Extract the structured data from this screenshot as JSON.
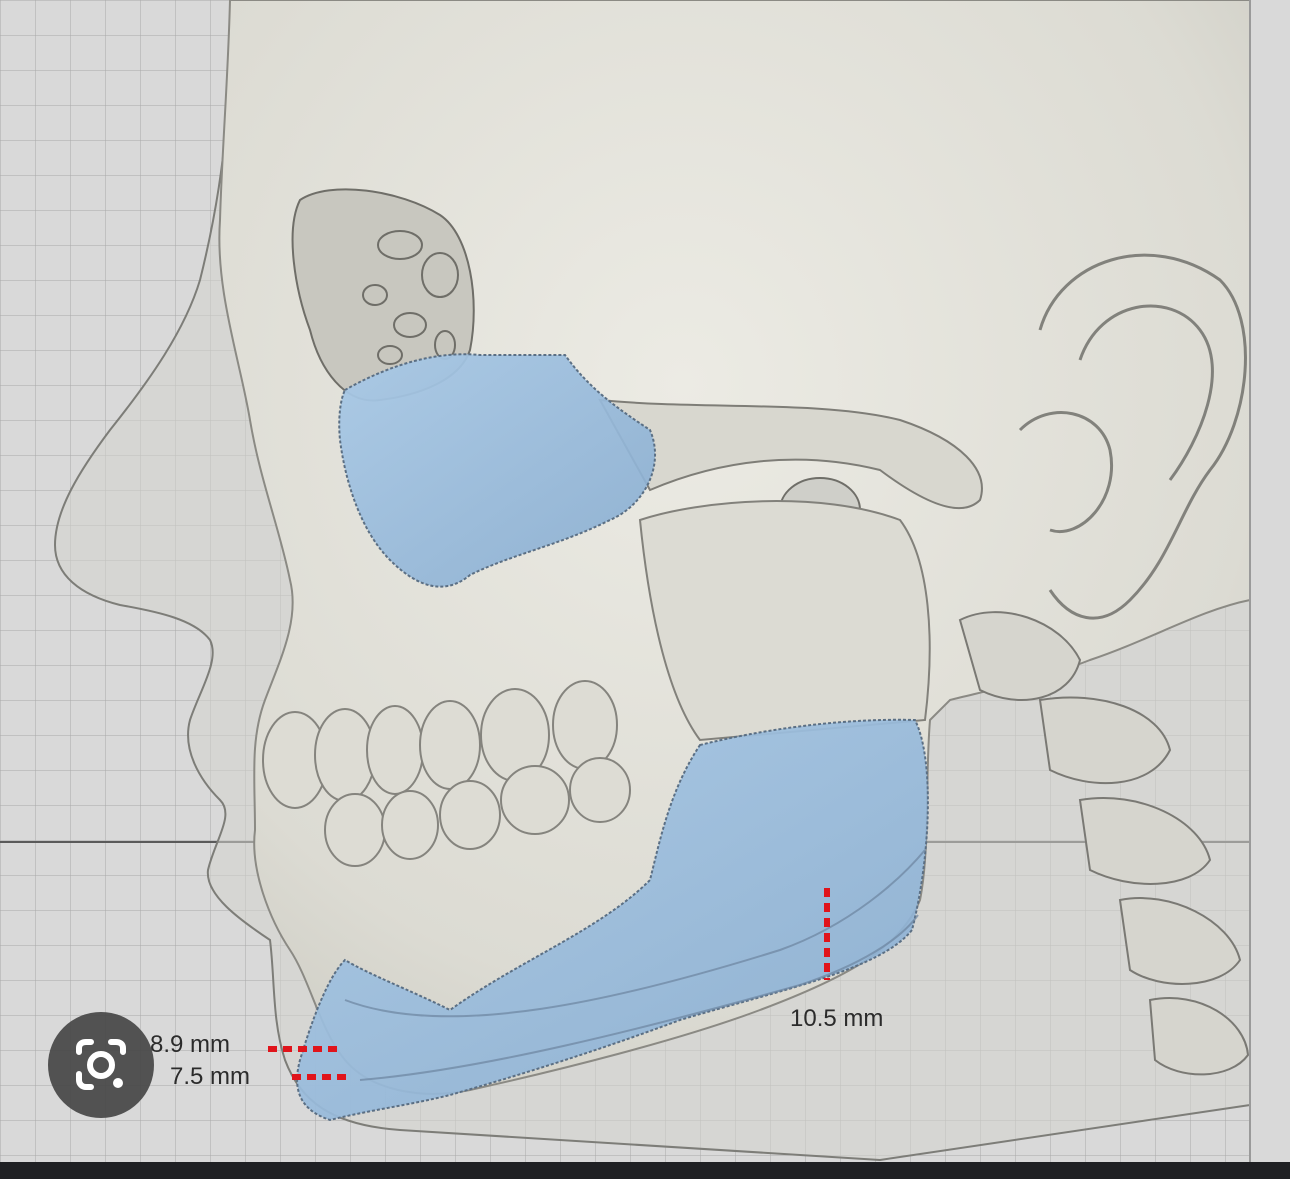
{
  "measurements": {
    "chin_upper": "8.9 mm",
    "chin_lower": "7.5 mm",
    "jaw_angle": "10.5 mm"
  },
  "icons": {
    "lens": "google-lens-icon"
  },
  "colors": {
    "grid_background": "#d9d9d9",
    "bone": "#e4e3dc",
    "implant": "#9ec0de",
    "measure_marker": "#e0141b",
    "bottom_bar": "#1f2023"
  }
}
